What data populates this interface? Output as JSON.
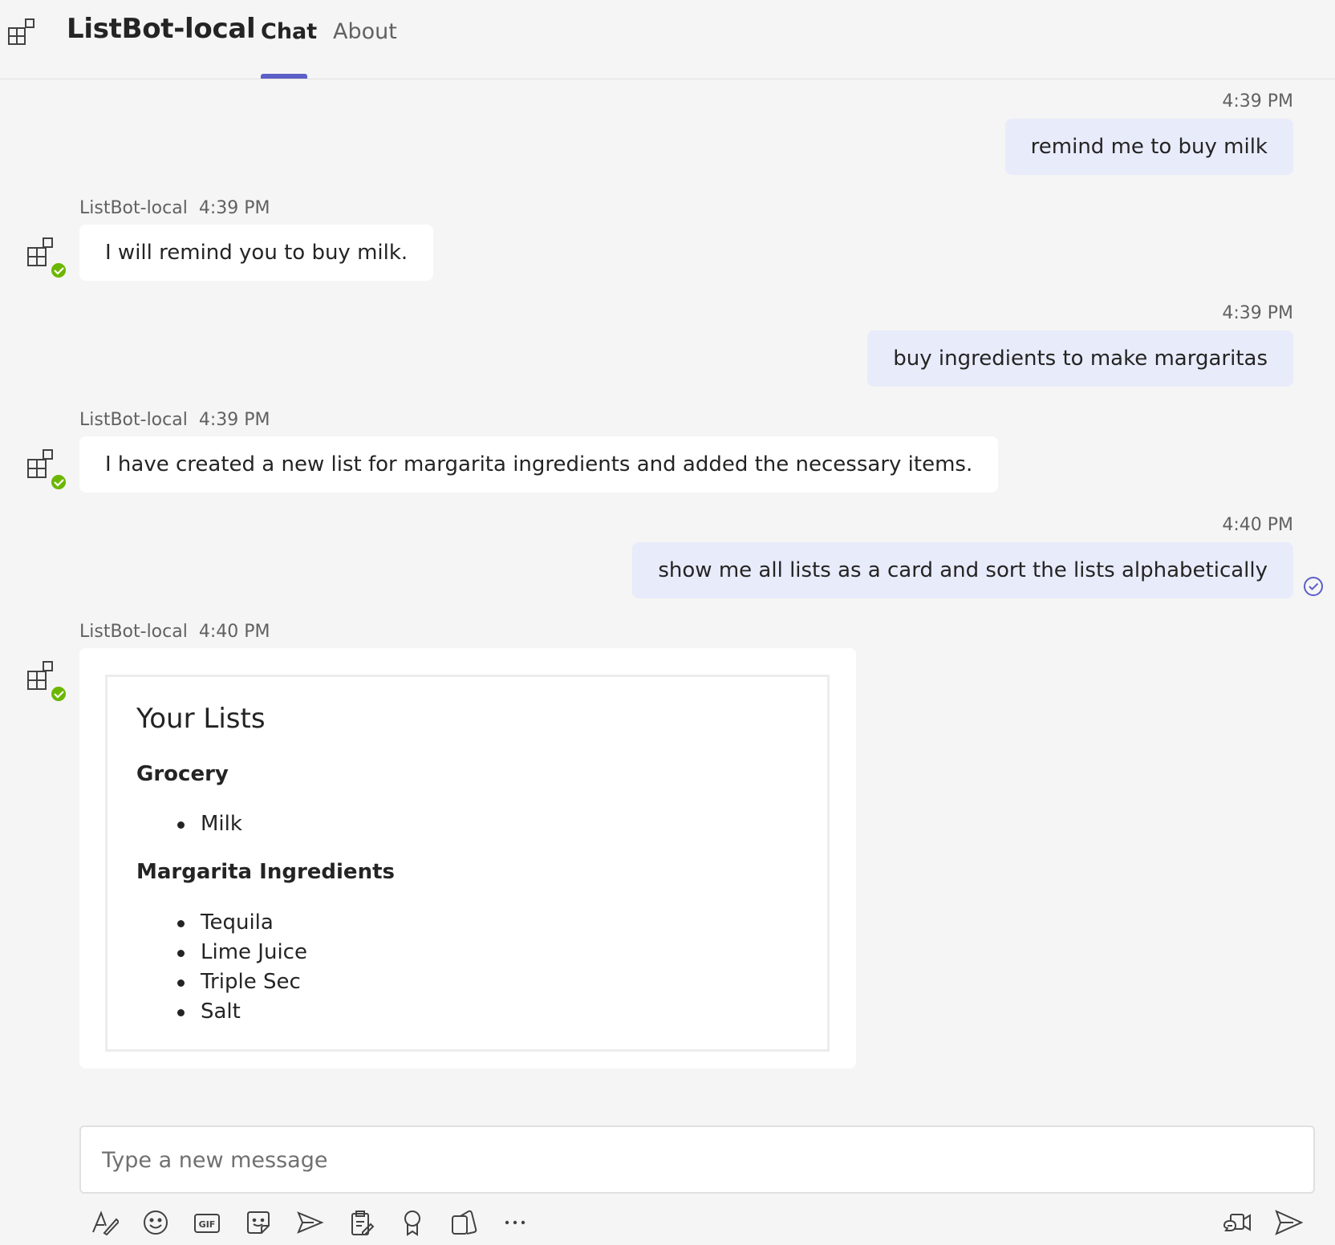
{
  "header": {
    "app_title": "ListBot-local",
    "tabs": [
      {
        "label": "Chat",
        "active": true
      },
      {
        "label": "About",
        "active": false
      }
    ]
  },
  "messages": [
    {
      "from": "user",
      "time": "4:39 PM",
      "text": "remind me to buy milk"
    },
    {
      "from": "bot",
      "sender": "ListBot-local",
      "time": "4:39 PM",
      "text": "I will remind you to buy milk."
    },
    {
      "from": "user",
      "time": "4:39 PM",
      "text": "buy ingredients to make margaritas"
    },
    {
      "from": "bot",
      "sender": "ListBot-local",
      "time": "4:39 PM",
      "text": "I have created a new list for margarita ingredients and added the necessary items."
    },
    {
      "from": "user",
      "time": "4:40 PM",
      "text": "show me all lists as a card and sort the lists alphabetically"
    },
    {
      "from": "bot",
      "sender": "ListBot-local",
      "time": "4:40 PM",
      "card": true
    }
  ],
  "card": {
    "title": "Your Lists",
    "lists": [
      {
        "name": "Grocery",
        "items": [
          "Milk"
        ]
      },
      {
        "name": "Margarita Ingredients",
        "items": [
          "Tequila",
          "Lime Juice",
          "Triple Sec",
          "Salt"
        ]
      }
    ]
  },
  "compose": {
    "placeholder": "Type a new message",
    "value": ""
  },
  "toolbar": {
    "icons": [
      "format-icon",
      "emoji-icon",
      "gif-icon",
      "sticker-icon",
      "schedule-meeting-icon",
      "loop-component-icon",
      "praise-icon",
      "apps-icon",
      "more-options-icon",
      "meet-now-icon",
      "send-icon"
    ]
  },
  "colors": {
    "accent": "#5b5fc7",
    "outgoing_bubble": "#e8ebfa",
    "status_green": "#6bb700",
    "background": "#f5f5f5"
  }
}
